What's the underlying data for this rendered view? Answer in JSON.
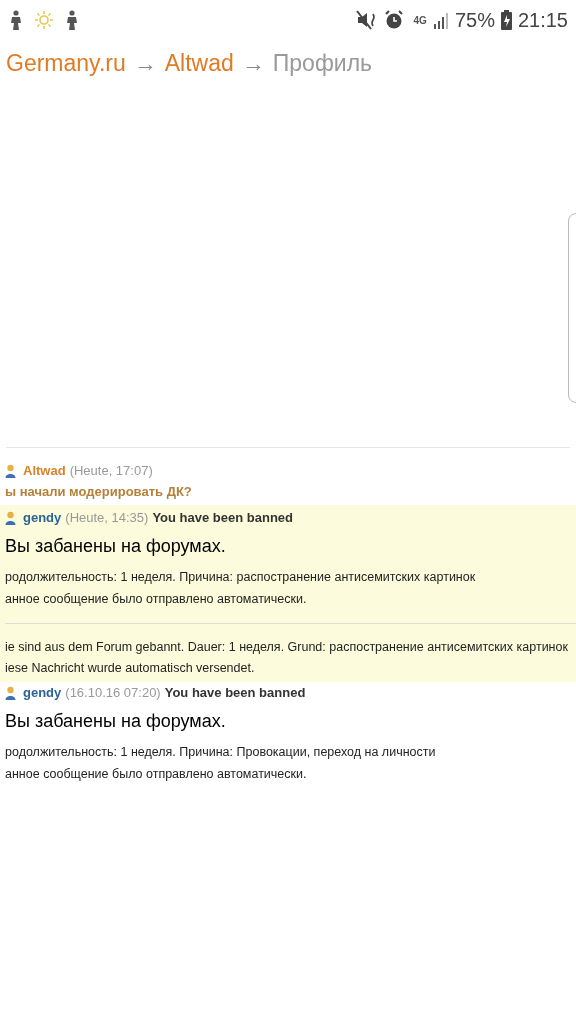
{
  "status_bar": {
    "network": "4G",
    "battery": "75%",
    "time": "21:15"
  },
  "breadcrumb": [
    {
      "label": "Germany.ru",
      "kind": "link"
    },
    {
      "label": "→",
      "kind": "separator"
    },
    {
      "label": "Altwad",
      "kind": "link"
    },
    {
      "label": "→",
      "kind": "separator"
    },
    {
      "label": "Профиль",
      "kind": "current"
    }
  ],
  "messages": [
    {
      "author": "Altwad",
      "color": "#d9822b",
      "time": "(Heute, 17:07)",
      "highlighted": false,
      "kind": "comment",
      "body": "ы начали модерировать ДК?"
    },
    {
      "author": "gendy",
      "color": "#2a6496",
      "time": "(Heute, 14:35)",
      "subject": "You have been banned",
      "highlighted": true,
      "kind": "notice",
      "heading": "Вы забанены на форумах.",
      "lines": [
        "родолжительность: 1 неделя. Причина: распостранение антисемитских картинок",
        "анное сообщение было отправлено автоматически."
      ],
      "extra_lines": [
        "ie sind aus dem Forum gebannt. Dauer: 1 неделя. Grund: распостранение антисемитских картинок",
        "iese Nachricht wurde automatisch versendet."
      ]
    },
    {
      "author": "gendy",
      "color": "#2a6496",
      "time": "(16.10.16 07:20)",
      "subject": "You have been banned",
      "highlighted": false,
      "kind": "notice",
      "heading": "Вы забанены на форумах.",
      "lines": [
        "родолжительность: 1 неделя. Причина: Провокации, переход на личности",
        "анное сообщение было отправлено автоматически."
      ]
    }
  ]
}
